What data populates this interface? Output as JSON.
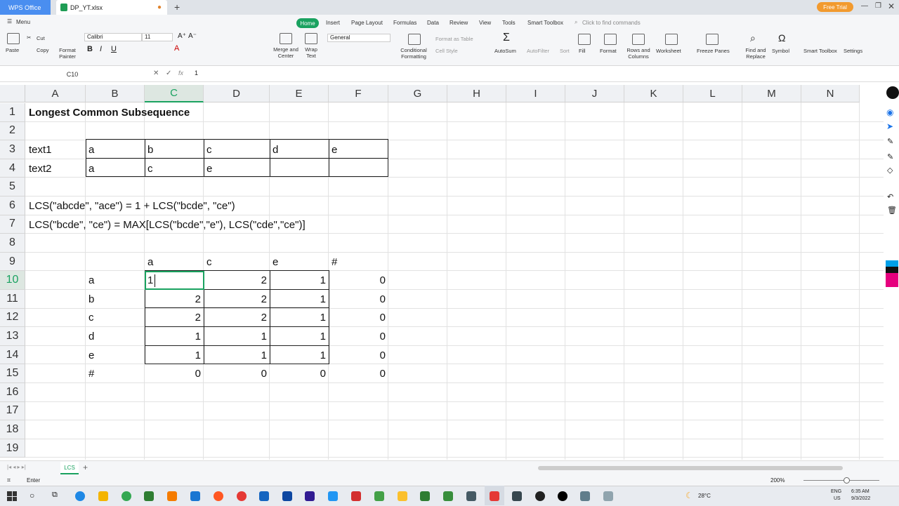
{
  "window": {
    "app_tab": "WPS Office",
    "file_tab": "DP_YT.xlsx",
    "free_trial": "Free Trial"
  },
  "menu": {
    "menu_label": "Menu",
    "tabs": [
      "Home",
      "Insert",
      "Page Layout",
      "Formulas",
      "Data",
      "Review",
      "View",
      "Tools",
      "Smart Toolbox"
    ],
    "search_placeholder": "Click to find commands"
  },
  "ribbon": {
    "cut": "Cut",
    "copy": "Copy",
    "paste": "Paste",
    "format_painter": "Format Painter",
    "font_name": "Calibri",
    "font_size": "11",
    "number_format": "General",
    "merge_center": "Merge and Center",
    "wrap_text": "Wrap Text",
    "conditional_formatting": "Conditional Formatting",
    "format_as_table": "Format as Table",
    "cell_style": "Cell Style",
    "autosum": "AutoSum",
    "autofilter": "AutoFilter",
    "sort": "Sort",
    "fill": "Fill",
    "format": "Format",
    "rows_columns": "Rows and Columns",
    "worksheet": "Worksheet",
    "freeze_panes": "Freeze Panes",
    "find_replace": "Find and Replace",
    "symbol": "Symbol",
    "smart_toolbox": "Smart Toolbox",
    "settings": "Settings"
  },
  "formula_bar": {
    "name_box": "C10",
    "fx": "fx",
    "value": "1"
  },
  "grid": {
    "columns": [
      "A",
      "B",
      "C",
      "D",
      "E",
      "F",
      "G",
      "H",
      "I",
      "J",
      "K",
      "L",
      "M",
      "N"
    ],
    "rows": [
      "1",
      "2",
      "3",
      "4",
      "5",
      "6",
      "7",
      "8",
      "9",
      "10",
      "11",
      "12",
      "13",
      "14",
      "15",
      "16",
      "17",
      "18",
      "19"
    ],
    "title": "Longest Common Subsequence",
    "text1_label": "text1",
    "text2_label": "text2",
    "text1_chars": [
      "a",
      "b",
      "c",
      "d",
      "e"
    ],
    "text2_chars": [
      "a",
      "c",
      "e"
    ],
    "formula_line1": "LCS(\"abcde\", \"ace\") = 1 + LCS(\"bcde\", \"ce\")",
    "formula_line2": "LCS(\"bcde\", \"ce\") = MAX[LCS(\"bcde\",\"e\"), LCS(\"cde\",\"ce\")]",
    "dp_col_headers": [
      "a",
      "c",
      "e",
      "#"
    ],
    "dp_row_headers": [
      "a",
      "b",
      "c",
      "d",
      "e",
      "#"
    ],
    "dp_values": [
      [
        "1",
        "2",
        "1",
        "0"
      ],
      [
        "2",
        "2",
        "1",
        "0"
      ],
      [
        "2",
        "2",
        "1",
        "0"
      ],
      [
        "1",
        "1",
        "1",
        "0"
      ],
      [
        "1",
        "1",
        "1",
        "0"
      ],
      [
        "0",
        "0",
        "0",
        "0"
      ]
    ]
  },
  "sheets": {
    "active": "LCS"
  },
  "status": {
    "mode": "Enter",
    "zoom": "200%",
    "weather": "28°C",
    "lang": "ENG",
    "region": "US",
    "time": "6:35 AM",
    "date": "9/3/2022"
  },
  "colors": {
    "accent": "#1aa260",
    "wps_blue": "#4a8ef0",
    "trial_orange": "#f29a2e"
  }
}
